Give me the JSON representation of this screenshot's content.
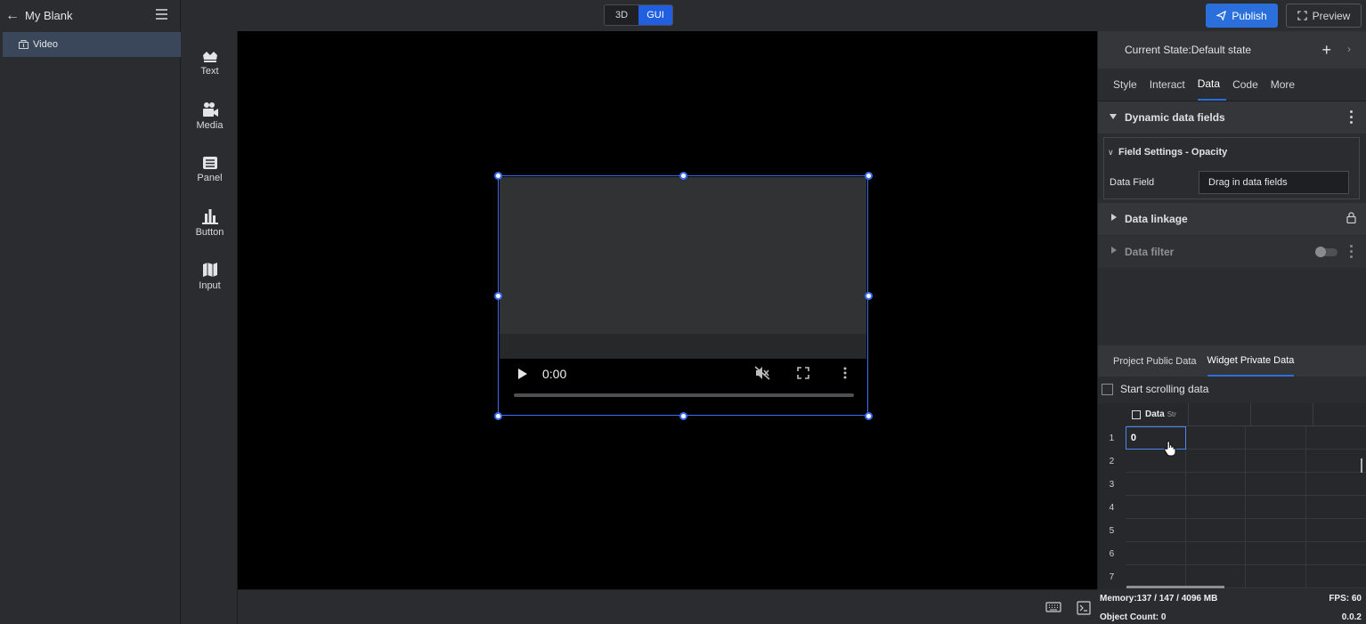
{
  "header": {
    "project_title": "My Blank",
    "mode_3d": "3D",
    "mode_gui": "GUI",
    "publish_label": "Publish",
    "preview_label": "Preview",
    "accent_color": "#2a6fdb"
  },
  "layers": {
    "items": [
      {
        "label": "Video",
        "icon": "layer-widget-icon",
        "selected": true
      }
    ]
  },
  "toolbox": {
    "items": [
      {
        "label": "Text",
        "icon": "text-icon"
      },
      {
        "label": "Media",
        "icon": "media-icon"
      },
      {
        "label": "Panel",
        "icon": "panel-icon"
      },
      {
        "label": "Button",
        "icon": "chart-bar-icon"
      },
      {
        "label": "Input",
        "icon": "input-icon"
      }
    ]
  },
  "canvas": {
    "video": {
      "time": "0:00",
      "progress": 0,
      "muted": true
    }
  },
  "inspector": {
    "state_label": "Current State:Default state",
    "tabs": [
      "Style",
      "Interact",
      "Data",
      "Code",
      "More"
    ],
    "active_tab": "Data",
    "sections": {
      "dynamic_fields": "Dynamic data fields",
      "field_settings": "Field Settings - Opacity",
      "data_field_label": "Data Field",
      "data_field_placeholder": "Drag in data fields",
      "data_linkage": "Data linkage",
      "data_filter": "Data filter"
    },
    "data_tabs": [
      "Project Public Data",
      "Widget Private Data"
    ],
    "active_data_tab": "Widget Private Data",
    "scroll_label": "Start scrolling data",
    "grid": {
      "column_header": "Data",
      "column_header_overlay": "Str",
      "rows": [
        "1",
        "2",
        "3",
        "4",
        "5",
        "6",
        "7"
      ],
      "values": [
        "0",
        "",
        "",
        "",
        "",
        "",
        ""
      ]
    }
  },
  "status": {
    "memory": "Memory:137 / 147 / 4096 MB",
    "fps": "FPS: 60",
    "object_count": "Object Count: 0",
    "version": "0.0.2"
  }
}
